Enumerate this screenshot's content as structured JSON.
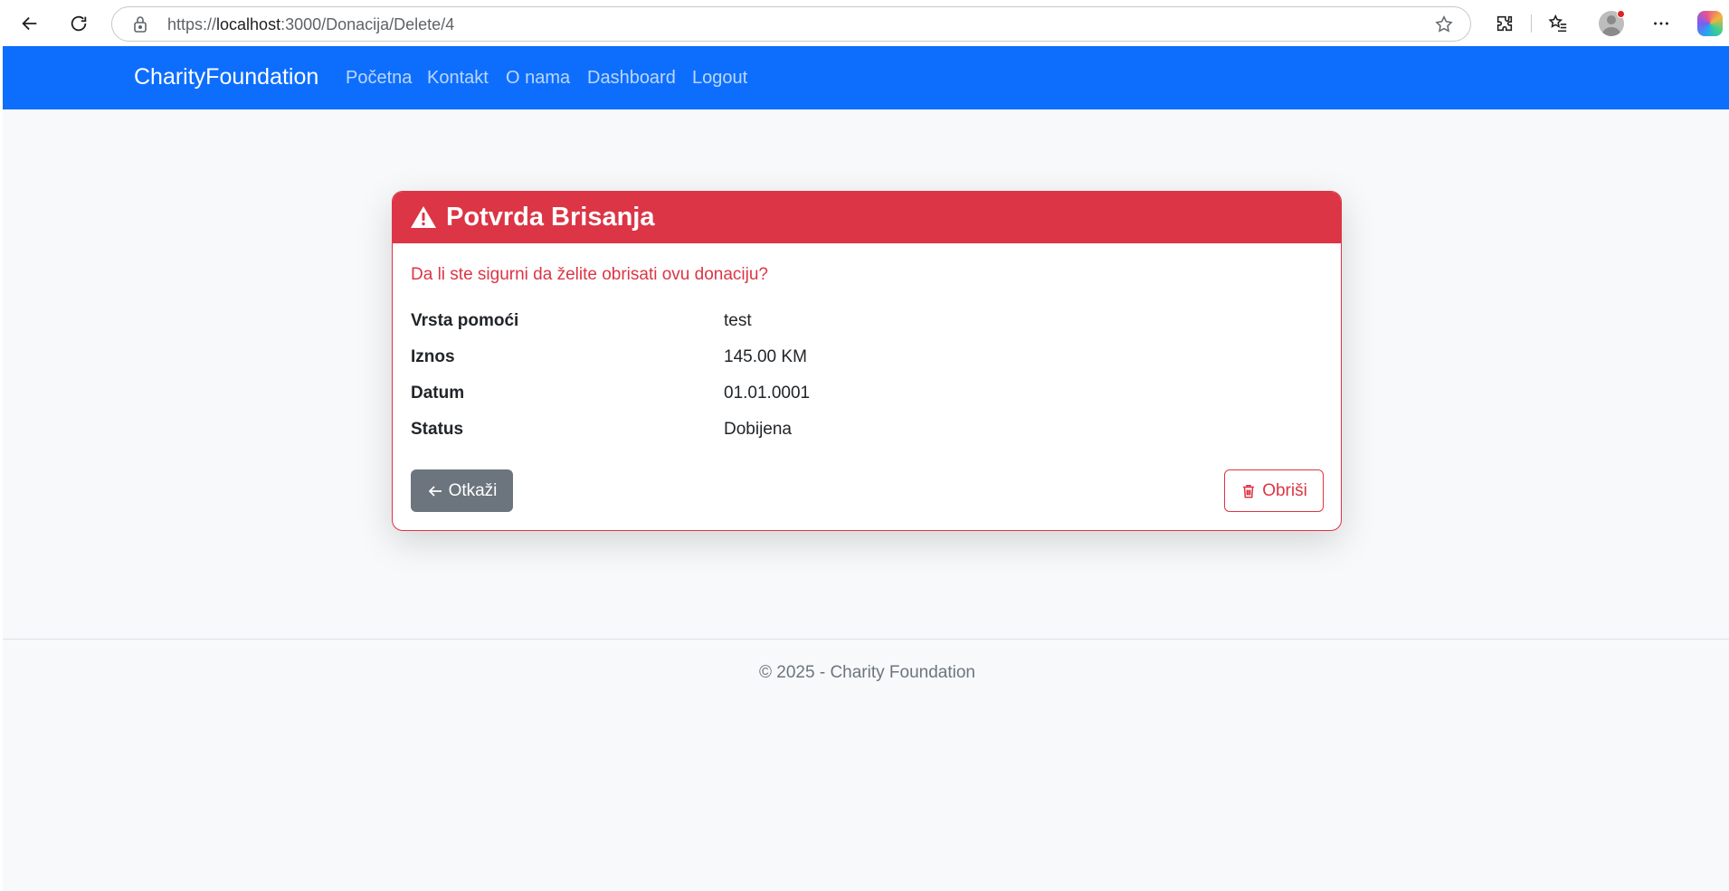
{
  "browser": {
    "url_prefix": "https://",
    "url_host": "localhost",
    "url_rest": ":3000/Donacija/Delete/4"
  },
  "navbar": {
    "brand": "CharityFoundation",
    "links": [
      {
        "label": "Početna"
      },
      {
        "label": "Kontakt"
      },
      {
        "label": "O nama"
      },
      {
        "label": "Dashboard"
      },
      {
        "label": "Logout"
      }
    ]
  },
  "card": {
    "title": "Potvrda Brisanja",
    "question": "Da li ste sigurni da želite obrisati ovu donaciju?",
    "details": [
      {
        "term": "Vrsta pomoći",
        "value": "test"
      },
      {
        "term": "Iznos",
        "value": "145.00 KM"
      },
      {
        "term": "Datum",
        "value": "01.01.0001"
      },
      {
        "term": "Status",
        "value": "Dobijena"
      }
    ],
    "cancel_label": "Otkaži",
    "delete_label": "Obriši"
  },
  "footer": {
    "text": "© 2025 - Charity Foundation"
  },
  "colors": {
    "primary": "#0d6efd",
    "danger": "#dc3545",
    "secondary": "#6c757d"
  }
}
